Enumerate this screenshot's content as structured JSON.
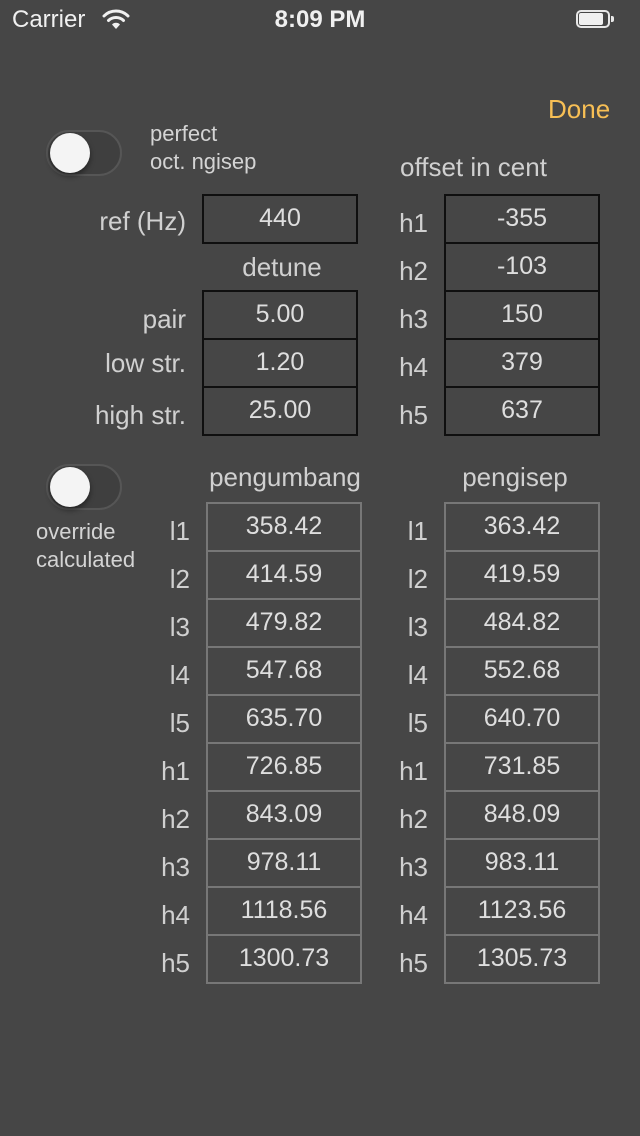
{
  "status_bar": {
    "carrier": "Carrier",
    "time": "8:09 PM"
  },
  "done_label": "Done",
  "perfect_octave": {
    "label_line1": "perfect",
    "label_line2": "oct. ngisep",
    "on": false
  },
  "offset_header": "offset in cent",
  "ref": {
    "label": "ref (Hz)",
    "value": "440"
  },
  "detune": {
    "header": "detune",
    "rows": [
      {
        "label": "pair",
        "value": "5.00"
      },
      {
        "label": "low str.",
        "value": "1.20"
      },
      {
        "label": "high str.",
        "value": "25.00"
      }
    ]
  },
  "offsets": [
    {
      "label": "h1",
      "value": "-355"
    },
    {
      "label": "h2",
      "value": "-103"
    },
    {
      "label": "h3",
      "value": "150"
    },
    {
      "label": "h4",
      "value": "379"
    },
    {
      "label": "h5",
      "value": "637"
    }
  ],
  "override": {
    "label_line1": "override",
    "label_line2": "calculated",
    "on": false
  },
  "pengumbang": {
    "header": "pengumbang",
    "rows": [
      {
        "label": "l1",
        "value": "358.42"
      },
      {
        "label": "l2",
        "value": "414.59"
      },
      {
        "label": "l3",
        "value": "479.82"
      },
      {
        "label": "l4",
        "value": "547.68"
      },
      {
        "label": "l5",
        "value": "635.70"
      },
      {
        "label": "h1",
        "value": "726.85"
      },
      {
        "label": "h2",
        "value": "843.09"
      },
      {
        "label": "h3",
        "value": "978.11"
      },
      {
        "label": "h4",
        "value": "1118.56"
      },
      {
        "label": "h5",
        "value": "1300.73"
      }
    ]
  },
  "pengisep": {
    "header": "pengisep",
    "rows": [
      {
        "label": "l1",
        "value": "363.42"
      },
      {
        "label": "l2",
        "value": "419.59"
      },
      {
        "label": "l3",
        "value": "484.82"
      },
      {
        "label": "l4",
        "value": "552.68"
      },
      {
        "label": "l5",
        "value": "640.70"
      },
      {
        "label": "h1",
        "value": "731.85"
      },
      {
        "label": "h2",
        "value": "848.09"
      },
      {
        "label": "h3",
        "value": "983.11"
      },
      {
        "label": "h4",
        "value": "1123.56"
      },
      {
        "label": "h5",
        "value": "1305.73"
      }
    ]
  }
}
